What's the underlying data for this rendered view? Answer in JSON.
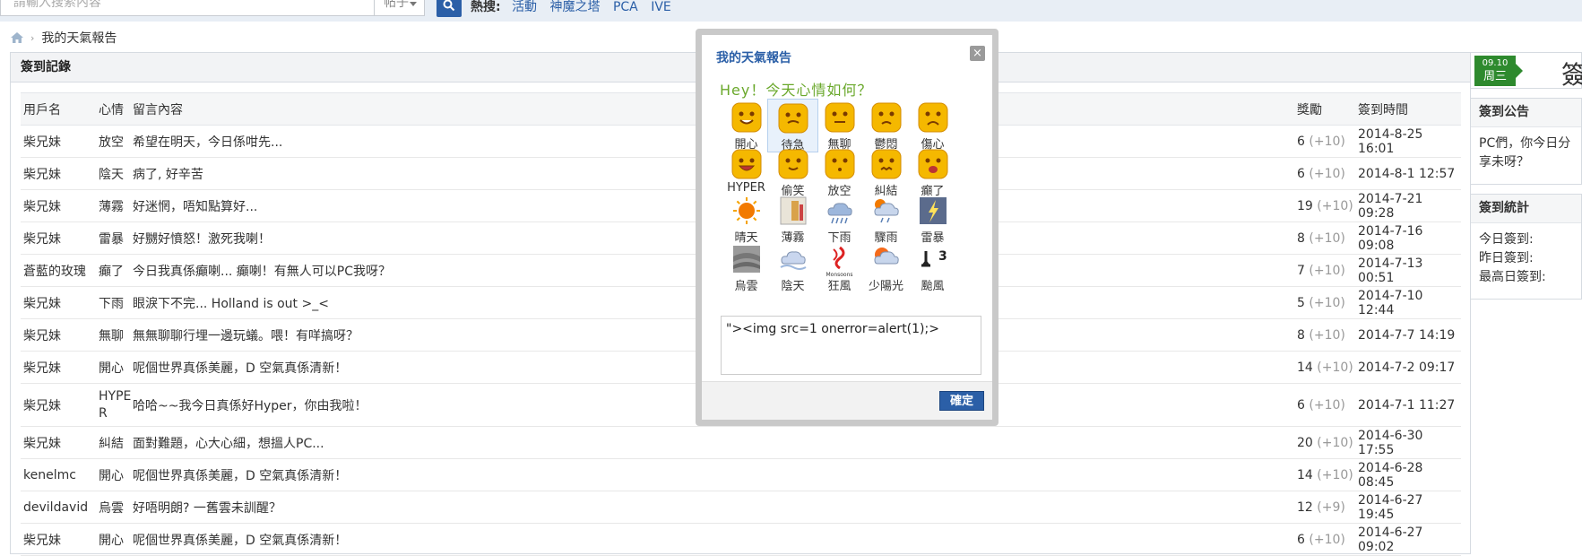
{
  "search": {
    "placeholder": "請輸入搜索內容",
    "scope": "帖子",
    "hot_label": "熱搜:",
    "hot_links": [
      "活動",
      "神魔之塔",
      "PCA",
      "IVE"
    ]
  },
  "breadcrumb": {
    "current": "我的天氣報告"
  },
  "panel": {
    "title": "簽到記錄"
  },
  "table": {
    "headers": {
      "user": "用戶名",
      "mood": "心情",
      "message": "留言內容",
      "reward": "獎勵",
      "time": "簽到時間"
    },
    "rows": [
      {
        "user": "柴兄妹",
        "mood": "放空",
        "message": "希望在明天，今日係咁先...",
        "reward": "6",
        "bonus": "(+10)",
        "time": "2014-8-25 16:01"
      },
      {
        "user": "柴兄妹",
        "mood": "陰天",
        "message": "病了, 好辛苦",
        "reward": "6",
        "bonus": "(+10)",
        "time": "2014-8-1 12:57"
      },
      {
        "user": "柴兄妹",
        "mood": "薄霧",
        "message": "好迷惘，唔知點算好...",
        "reward": "19",
        "bonus": "(+10)",
        "time": "2014-7-21 09:28"
      },
      {
        "user": "柴兄妹",
        "mood": "雷暴",
        "message": "好嬲好憤怒！激死我喇！",
        "reward": "8",
        "bonus": "(+10)",
        "time": "2014-7-16 09:08"
      },
      {
        "user": "蒼藍的玫瑰",
        "mood": "癲了",
        "message": "今日我真係癲喇... 癲喇！有無人可以PC我呀？",
        "reward": "7",
        "bonus": "(+10)",
        "time": "2014-7-13 00:51"
      },
      {
        "user": "柴兄妹",
        "mood": "下雨",
        "message": "眼淚下不完... Holland is out >_<",
        "reward": "5",
        "bonus": "(+10)",
        "time": "2014-7-10 12:44"
      },
      {
        "user": "柴兄妹",
        "mood": "無聊",
        "message": "無無聊聊行埋一邊玩蟻。喂！有咩搞呀？",
        "reward": "8",
        "bonus": "(+10)",
        "time": "2014-7-7 14:19"
      },
      {
        "user": "柴兄妹",
        "mood": "開心",
        "message": "呢個世界真係美麗，D 空氣真係清新！",
        "reward": "14",
        "bonus": "(+10)",
        "time": "2014-7-2 09:17"
      },
      {
        "user": "柴兄妹",
        "mood": "HYPER",
        "message": "哈哈~~我今日真係好Hyper，你由我啦！",
        "reward": "6",
        "bonus": "(+10)",
        "time": "2014-7-1 11:27"
      },
      {
        "user": "柴兄妹",
        "mood": "糾結",
        "message": "面對難題，心大心細，想搵人PC...",
        "reward": "20",
        "bonus": "(+10)",
        "time": "2014-6-30 17:55"
      },
      {
        "user": "kenelmc",
        "mood": "開心",
        "message": "呢個世界真係美麗，D 空氣真係清新！",
        "reward": "14",
        "bonus": "(+10)",
        "time": "2014-6-28 08:45"
      },
      {
        "user": "devildavid",
        "mood": "烏雲",
        "message": "好唔明朗? 一舊雲未訓醒？",
        "reward": "12",
        "bonus": "(+9)",
        "time": "2014-6-27 19:45"
      },
      {
        "user": "柴兄妹",
        "mood": "開心",
        "message": "呢個世界真係美麗，D 空氣真係清新！",
        "reward": "6",
        "bonus": "(+10)",
        "time": "2014-6-27 09:02"
      }
    ]
  },
  "sidebar": {
    "date_top": "09.10",
    "date_weekday": "周三",
    "big_text": "簽",
    "notice_title": "簽到公告",
    "notice_text": "PC們，你今日分享未呀？",
    "stats_title": "簽到統計",
    "stats": [
      "今日簽到:",
      "昨日簽到:",
      "最高日簽到:"
    ]
  },
  "modal": {
    "title": "我的天氣報告",
    "close": "×",
    "greeting": "Hey！今天心情如何？",
    "moods": [
      {
        "label": "開心",
        "icon": "happy-face-icon"
      },
      {
        "label": "待急",
        "icon": "anxious-face-icon",
        "selected": true
      },
      {
        "label": "無聊",
        "icon": "bored-face-icon"
      },
      {
        "label": "鬱悶",
        "icon": "gloomy-face-icon"
      },
      {
        "label": "傷心",
        "icon": "sad-face-icon"
      },
      {
        "label": "HYPER",
        "icon": "hyper-face-icon"
      },
      {
        "label": "偷笑",
        "icon": "giggle-face-icon"
      },
      {
        "label": "放空",
        "icon": "blank-face-icon"
      },
      {
        "label": "糾結",
        "icon": "tangled-face-icon"
      },
      {
        "label": "癲了",
        "icon": "crazy-face-icon"
      },
      {
        "label": "晴天",
        "icon": "sun-icon"
      },
      {
        "label": "薄霧",
        "icon": "mist-icon"
      },
      {
        "label": "下雨",
        "icon": "rain-icon"
      },
      {
        "label": "驟雨",
        "icon": "shower-icon"
      },
      {
        "label": "雷暴",
        "icon": "thunderstorm-icon"
      },
      {
        "label": "烏雲",
        "icon": "dark-cloud-icon"
      },
      {
        "label": "陰天",
        "icon": "overcast-icon"
      },
      {
        "label": "狂風",
        "icon": "monsoon-icon"
      },
      {
        "label": "少陽光",
        "icon": "partly-sunny-icon"
      },
      {
        "label": "颱風",
        "icon": "typhoon-signal-icon"
      }
    ],
    "monsoon_text": "Monsoons",
    "typhoon_text": "3",
    "input_value": "\"><img src=1 onerror=alert(1);>",
    "ok": "確定"
  },
  "colors": {
    "accent": "#2b5fa7",
    "green": "#2e8a2e",
    "face": "#f5b800"
  }
}
